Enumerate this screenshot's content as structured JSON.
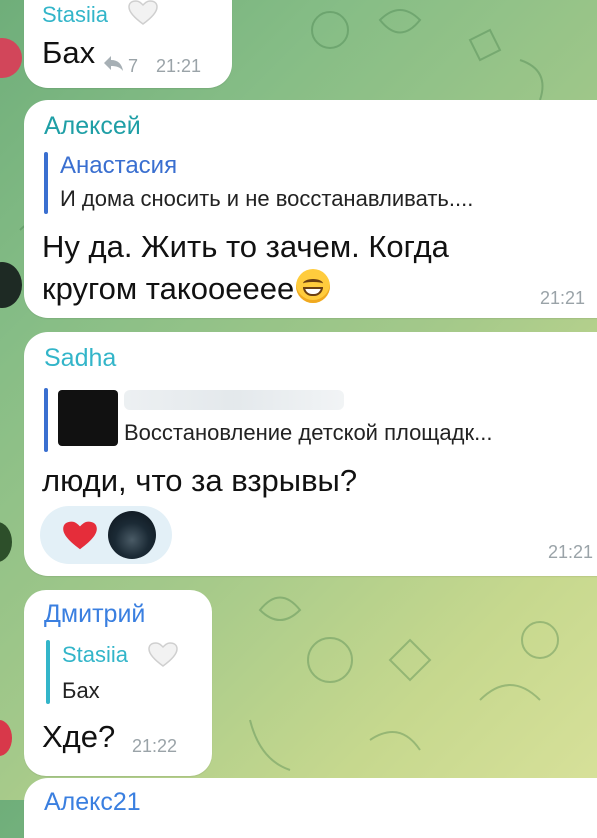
{
  "messages": [
    {
      "sender": "Stasiia",
      "sender_color": "#33b5c9",
      "text": "Бах",
      "forwards": "7",
      "time": "21:21"
    },
    {
      "sender": "Алексей",
      "sender_color": "#1f9fa6",
      "reply": {
        "name": "Анастасия",
        "text": "И дома сносить и не восстанавливать....",
        "color": "#3a6fd0"
      },
      "text_line1": "Ну да. Жить то зачем. Когда",
      "text_line2": "кругом такооееее",
      "time": "21:21"
    },
    {
      "sender": "Sadha",
      "sender_color": "#33b5c9",
      "reply": {
        "text": "Восстановление детской площадк...",
        "color": "#3a6fd0"
      },
      "text": "люди, что за взрывы?",
      "reactions": [
        "heart-emoji",
        "user-photo"
      ],
      "time": "21:21"
    },
    {
      "sender": "Дмитрий",
      "sender_color": "#3a7fe0",
      "reply": {
        "name": "Stasiia",
        "text": "Бах",
        "color": "#33b5c9"
      },
      "text": "Хде?",
      "time": "21:22"
    },
    {
      "sender": "Алекс21",
      "sender_color": "#3a7fe0"
    }
  ]
}
